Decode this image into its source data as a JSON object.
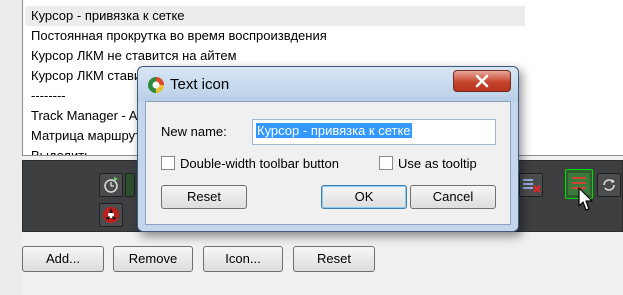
{
  "list": {
    "items": [
      {
        "label": "Курсор - привязка к сетке",
        "selected": true
      },
      {
        "label": "Постоянная прокрутка во время воспроизвдения"
      },
      {
        "label": "Курсор ЛКМ не ставится на айтем"
      },
      {
        "label": "Курсор ЛКМ ставится на айтем"
      },
      {
        "label": "--------"
      },
      {
        "label": "Track Manager - Add"
      },
      {
        "label": "Матрица маршрутизации"
      },
      {
        "label": "Выделить…"
      }
    ]
  },
  "bottom_buttons": {
    "add": "Add...",
    "remove": "Remove",
    "icon": "Icon...",
    "reset": "Reset"
  },
  "dialog": {
    "title": "Text icon",
    "new_name_label": "New name:",
    "new_name_value": "Курсор - привязка к сетке",
    "double_width_label": "Double-width toolbar button",
    "double_width_checked": false,
    "tooltip_label": "Use as tooltip",
    "tooltip_checked": false,
    "reset_label": "Reset",
    "ok_label": "OK",
    "cancel_label": "Cancel"
  },
  "colors": {
    "toolbar_bg": "#3d3f41",
    "selection": "#3399ff",
    "close_button": "#c6452e"
  }
}
